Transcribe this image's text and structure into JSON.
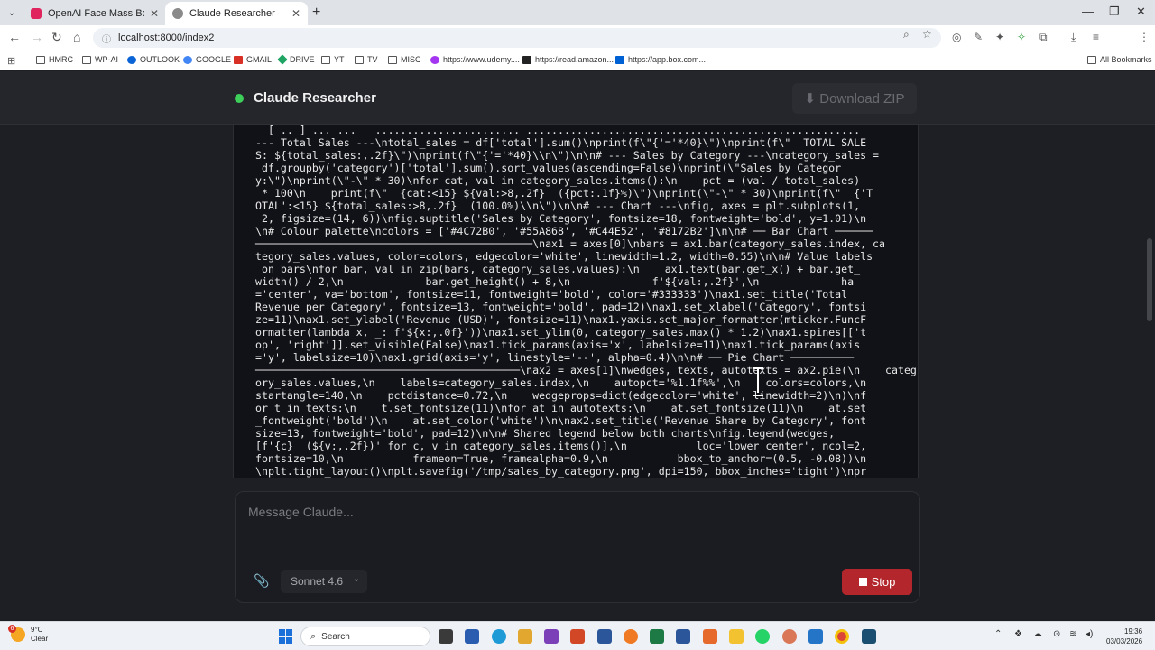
{
  "browser": {
    "tabs": [
      {
        "title": "OpenAI Face Mass Boycott Afte",
        "favicon_color": "#e0245e",
        "active": false
      },
      {
        "title": "Claude Researcher",
        "favicon_color": "#8a8a8a",
        "active": true
      }
    ],
    "url": "localhost:8000/index2",
    "bookmarks": [
      {
        "label": "HMRC",
        "icon": "folder-icon"
      },
      {
        "label": "WP-AI",
        "icon": "folder-icon"
      },
      {
        "label": "OUTLOOK",
        "icon": "outlook-icon"
      },
      {
        "label": "GOOGLE",
        "icon": "google-icon"
      },
      {
        "label": "GMAIL",
        "icon": "gmail-icon"
      },
      {
        "label": "DRIVE",
        "icon": "drive-icon"
      },
      {
        "label": "YT",
        "icon": "folder-icon"
      },
      {
        "label": "TV",
        "icon": "folder-icon"
      },
      {
        "label": "MISC",
        "icon": "folder-icon"
      },
      {
        "label": "https://www.udemy....",
        "icon": "udemy-icon"
      },
      {
        "label": "https://read.amazon...",
        "icon": "kindle-icon"
      },
      {
        "label": "https://app.box.com...",
        "icon": "box-icon"
      }
    ],
    "all_bookmarks": "All Bookmarks"
  },
  "app": {
    "title": "Claude Researcher",
    "download_label": "⬇ Download ZIP",
    "code_output": "  [ .. ] ... ...   ....................... .....................................................\n--- Total Sales ---\\ntotal_sales = df['total'].sum()\\nprint(f\\\"{'='*40}\\\")\\nprint(f\\\"  TOTAL SALE\nS: ${total_sales:,.2f}\\\")\\nprint(f\\\"{'='*40}\\\\n\\\")\\n\\n# --- Sales by Category ---\\ncategory_sales =\n df.groupby('category')['total'].sum().sort_values(ascending=False)\\nprint(\\\"Sales by Categor\ny:\\\")\\nprint(\\\"-\\\" * 30)\\nfor cat, val in category_sales.items():\\n    pct = (val / total_sales)\n * 100\\n    print(f\\\"  {cat:<15} ${val:>8,.2f}  ({pct:.1f}%)\\\")\\nprint(\\\"-\\\" * 30)\\nprint(f\\\"  {'T\nOTAL':<15} ${total_sales:>8,.2f}  (100.0%)\\\\n\\\")\\n\\n# --- Chart ---\\nfig, axes = plt.subplots(1,\n 2, figsize=(14, 6))\\nfig.suptitle('Sales by Category', fontsize=18, fontweight='bold', y=1.01)\\n\n\\n# Colour palette\\ncolors = ['#4C72B0', '#55A868', '#C44E52', '#8172B2']\\n\\n# ── Bar Chart ──────\n────────────────────────────────────────────\\nax1 = axes[0]\\nbars = ax1.bar(category_sales.index, ca\ntegory_sales.values, color=colors, edgecolor='white', linewidth=1.2, width=0.55)\\n\\n# Value labels\n on bars\\nfor bar, val in zip(bars, category_sales.values):\\n    ax1.text(bar.get_x() + bar.get_\nwidth() / 2,\\n             bar.get_height() + 8,\\n             f'${val:,.2f}',\\n             ha\n='center', va='bottom', fontsize=11, fontweight='bold', color='#333333')\\nax1.set_title('Total\nRevenue per Category', fontsize=13, fontweight='bold', pad=12)\\nax1.set_xlabel('Category', fontsi\nze=11)\\nax1.set_ylabel('Revenue (USD)', fontsize=11)\\nax1.yaxis.set_major_formatter(mticker.FuncF\normatter(lambda x, _: f'${x:,.0f}'))\\nax1.set_ylim(0, category_sales.max() * 1.2)\\nax1.spines[['t\nop', 'right']].set_visible(False)\\nax1.tick_params(axis='x', labelsize=11)\\nax1.tick_params(axis\n='y', labelsize=10)\\nax1.grid(axis='y', linestyle='--', alpha=0.4)\\n\\n# ── Pie Chart ──────────\n──────────────────────────────────────────\\nax2 = axes[1]\\nwedges, texts, autotexts = ax2.pie(\\n    categ\nory_sales.values,\\n    labels=category_sales.index,\\n    autopct='%1.1f%%',\\n    colors=colors,\\n\nstartangle=140,\\n    pctdistance=0.72,\\n    wedgeprops=dict(edgecolor='white', linewidth=2)\\n)\\nf\nor t in texts:\\n    t.set_fontsize(11)\\nfor at in autotexts:\\n    at.set_fontsize(11)\\n    at.set\n_fontweight('bold')\\n    at.set_color('white')\\n\\nax2.set_title('Revenue Share by Category', font\nsize=13, fontweight='bold', pad=12)\\n\\n# Shared legend below both charts\\nfig.legend(wedges,\n[f'{c}  (${v:,.2f})' for c, v in category_sales.items()],\\n           loc='lower center', ncol=2,\nfontsize=10,\\n           frameon=True, framealpha=0.9,\\n           bbox_to_anchor=(0.5, -0.08))\\n\n\\nplt.tight_layout()\\nplt.savefig('/tmp/sales_by_category.png', dpi=150, bbox_inches='tight')\\npr\nint(\\\"Chart saved to /tmp/sales_by_category.png\\\")\\n\"",
    "composer": {
      "placeholder": "Message Claude...",
      "model": "Sonnet 4.6",
      "stop_label": "Stop"
    }
  },
  "taskbar": {
    "weather_temp": "9°C",
    "weather_desc": "Clear",
    "weather_badge": "6",
    "search_label": "Search",
    "time": "19:36",
    "date": "03/03/2026"
  }
}
